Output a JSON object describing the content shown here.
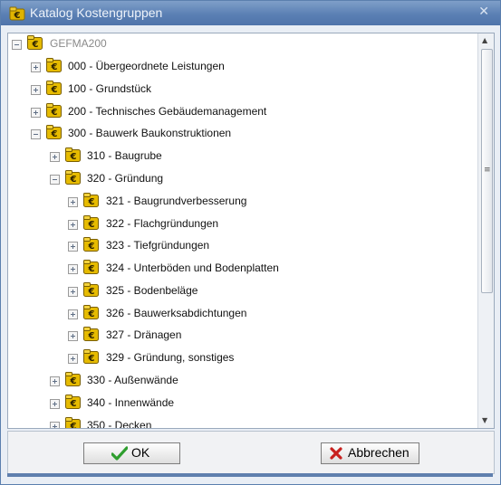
{
  "window": {
    "title": "Katalog Kostengruppen",
    "close_glyph": "✕"
  },
  "icons": {
    "node_icon": "euro-coin-folder-icon",
    "accent": "#d9b300"
  },
  "tree": {
    "root_label": "GEFMA200",
    "nodes": [
      {
        "label": "000 - Übergeordnete Leistungen",
        "state": "collapsed"
      },
      {
        "label": "100 - Grundstück",
        "state": "collapsed"
      },
      {
        "label": "200 - Technisches Gebäudemanagement",
        "state": "collapsed"
      },
      {
        "label": "300 - Bauwerk Baukonstruktionen",
        "state": "expanded"
      },
      {
        "label": "310 - Baugrube",
        "state": "collapsed"
      },
      {
        "label": "320 - Gründung",
        "state": "expanded"
      },
      {
        "label": "321 - Baugrundverbesserung",
        "state": "collapsed"
      },
      {
        "label": "322 - Flachgründungen",
        "state": "collapsed"
      },
      {
        "label": "323 - Tiefgründungen",
        "state": "collapsed"
      },
      {
        "label": "324 - Unterböden und Bodenplatten",
        "state": "collapsed"
      },
      {
        "label": "325 - Bodenbeläge",
        "state": "collapsed"
      },
      {
        "label": "326 - Bauwerksabdichtungen",
        "state": "collapsed"
      },
      {
        "label": "327 - Dränagen",
        "state": "collapsed"
      },
      {
        "label": "329 - Gründung, sonstiges",
        "state": "collapsed"
      },
      {
        "label": "330 - Außenwände",
        "state": "collapsed"
      },
      {
        "label": "340 - Innenwände",
        "state": "collapsed"
      },
      {
        "label": "350 - Decken",
        "state": "collapsed"
      }
    ]
  },
  "buttons": {
    "ok_label": "OK",
    "cancel_label": "Abbrechen",
    "ok_color": "#2e9e2e",
    "cancel_color": "#c8201e"
  }
}
